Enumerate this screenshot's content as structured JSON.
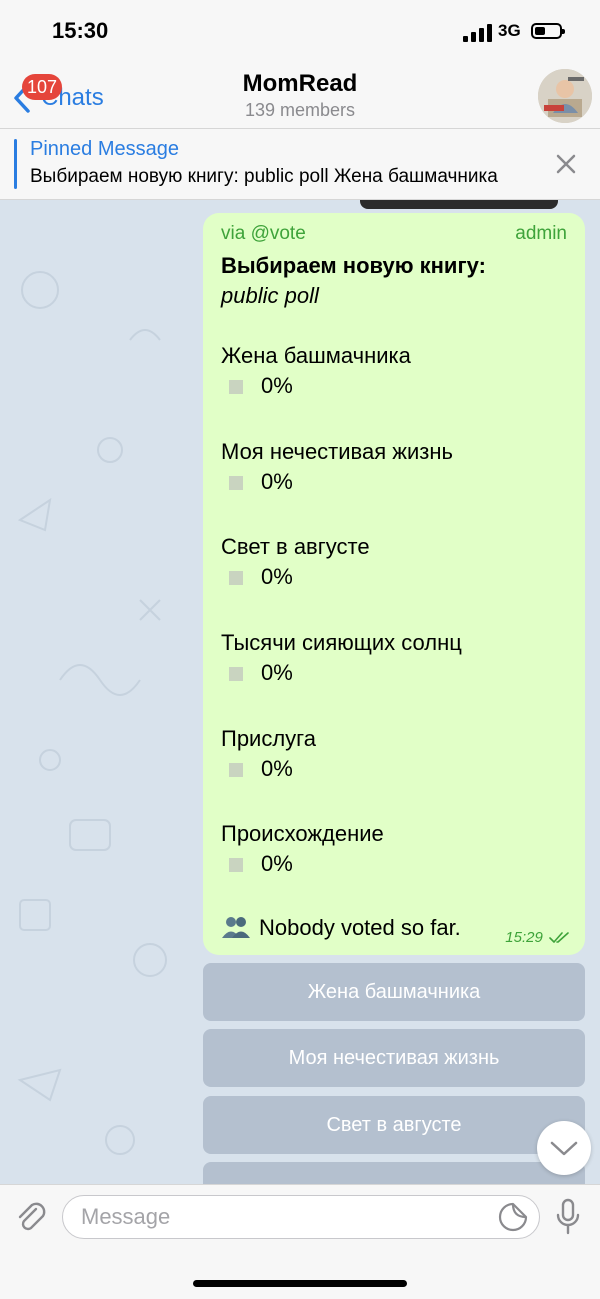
{
  "status_bar": {
    "time": "15:30",
    "network": "3G"
  },
  "header": {
    "back_label": "Chats",
    "unread_badge": "107",
    "title": "MomRead",
    "subtitle": "139 members"
  },
  "pinned": {
    "title": "Pinned Message",
    "text": "Выбираем новую книгу: public poll  Жена башмачника"
  },
  "poll": {
    "via": "via @vote",
    "role": "admin",
    "question": "Выбираем новую книгу:",
    "type": "public poll",
    "options": [
      {
        "label": "Жена башмачника",
        "percent": "0%"
      },
      {
        "label": "Моя нечестивая жизнь",
        "percent": "0%"
      },
      {
        "label": "Свет в августе",
        "percent": "0%"
      },
      {
        "label": "Тысячи сияющих солнц",
        "percent": "0%"
      },
      {
        "label": "Прислуга",
        "percent": "0%"
      },
      {
        "label": "Происхождение",
        "percent": "0%"
      }
    ],
    "voters_text": "Nobody voted so far.",
    "time": "15:29"
  },
  "keyboard_buttons": [
    {
      "label": "Жена башмачника"
    },
    {
      "label": "Моя нечестивая жизнь"
    },
    {
      "label": "Свет в августе"
    },
    {
      "label": ""
    }
  ],
  "composer": {
    "placeholder": "Message"
  },
  "icons": {
    "back": "chevron-left-icon",
    "close": "close-icon",
    "attach": "paperclip-icon",
    "sticker": "sticker-icon",
    "mic": "microphone-icon",
    "scroll": "chevron-down-icon",
    "voters": "people-icon",
    "read": "double-check-icon"
  },
  "colors": {
    "accent": "#2a7de1",
    "badge": "#e5453b",
    "bubble": "#e1ffc7",
    "poll_green": "#3ea33a"
  }
}
